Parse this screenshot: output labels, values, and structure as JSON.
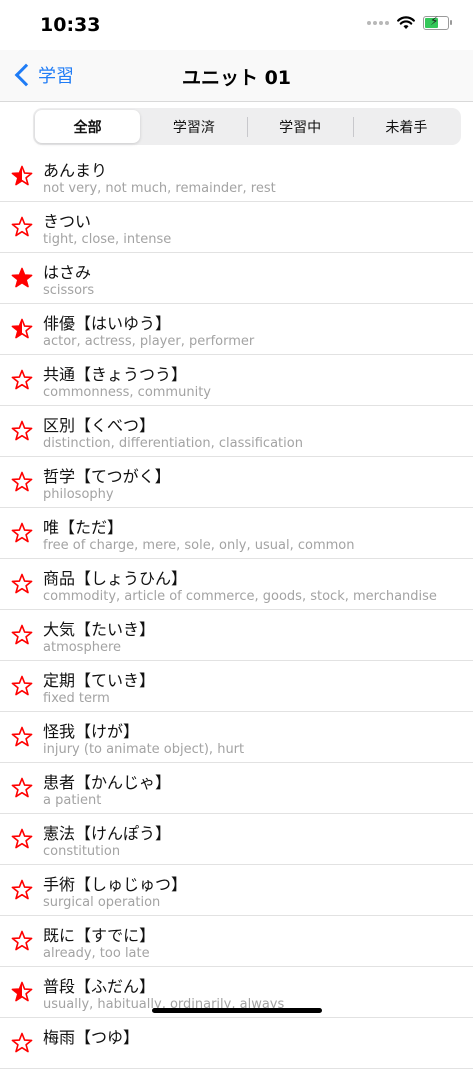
{
  "status": {
    "time": "10:33"
  },
  "nav": {
    "back_label": "学習",
    "title": "ユニット 01"
  },
  "segments": [
    "全部",
    "学習済",
    "学習中",
    "未着手"
  ],
  "colors": {
    "accent": "#1f7cf6",
    "star": "#ff0000",
    "battery": "#34c759"
  },
  "battery_level": 0.55,
  "items": [
    {
      "word": "あんまり",
      "meaning": "not very, not much, remainder, rest",
      "star": "half"
    },
    {
      "word": "きつい",
      "meaning": "tight, close, intense",
      "star": "empty"
    },
    {
      "word": "はさみ",
      "meaning": "scissors",
      "star": "full"
    },
    {
      "word": "俳優【はいゆう】",
      "meaning": "actor, actress, player, performer",
      "star": "half"
    },
    {
      "word": "共通【きょうつう】",
      "meaning": "commonness, community",
      "star": "empty"
    },
    {
      "word": "区別【くべつ】",
      "meaning": "distinction, differentiation, classification",
      "star": "empty"
    },
    {
      "word": "哲学【てつがく】",
      "meaning": "philosophy",
      "star": "empty"
    },
    {
      "word": "唯【ただ】",
      "meaning": "free of charge, mere, sole, only, usual, common",
      "star": "empty"
    },
    {
      "word": "商品【しょうひん】",
      "meaning": "commodity, article of commerce, goods, stock, merchandise",
      "star": "empty"
    },
    {
      "word": "大気【たいき】",
      "meaning": "atmosphere",
      "star": "empty"
    },
    {
      "word": "定期【ていき】",
      "meaning": "fixed term",
      "star": "empty"
    },
    {
      "word": "怪我【けが】",
      "meaning": "injury (to animate object), hurt",
      "star": "empty"
    },
    {
      "word": "患者【かんじゃ】",
      "meaning": "a patient",
      "star": "empty"
    },
    {
      "word": "憲法【けんぽう】",
      "meaning": "constitution",
      "star": "empty"
    },
    {
      "word": "手術【しゅじゅつ】",
      "meaning": "surgical operation",
      "star": "empty"
    },
    {
      "word": "既に【すでに】",
      "meaning": "already, too late",
      "star": "empty"
    },
    {
      "word": "普段【ふだん】",
      "meaning": "usually, habitually, ordinarily, always",
      "star": "half"
    },
    {
      "word": "梅雨【つゆ】",
      "meaning": "",
      "star": "empty"
    }
  ]
}
